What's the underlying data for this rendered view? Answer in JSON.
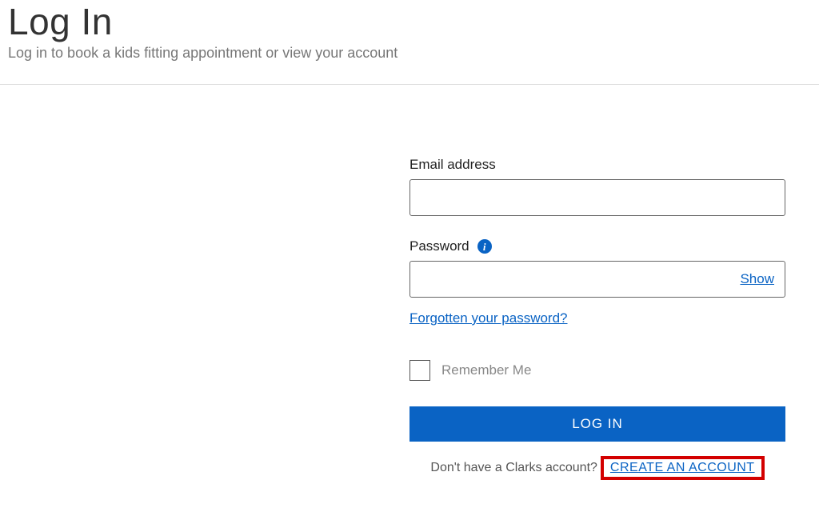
{
  "header": {
    "title": "Log In",
    "subtitle": "Log in to book a kids fitting appointment or view your account"
  },
  "form": {
    "email": {
      "label": "Email address",
      "value": ""
    },
    "password": {
      "label": "Password",
      "value": "",
      "show_toggle": "Show"
    },
    "forgot_link": "Forgotten your password?",
    "remember": {
      "label": "Remember Me",
      "checked": false
    },
    "submit_label": "LOG IN",
    "signup_prompt": "Don't have a Clarks account?",
    "create_account_link": "CREATE AN ACCOUNT"
  },
  "icons": {
    "info": "i"
  }
}
